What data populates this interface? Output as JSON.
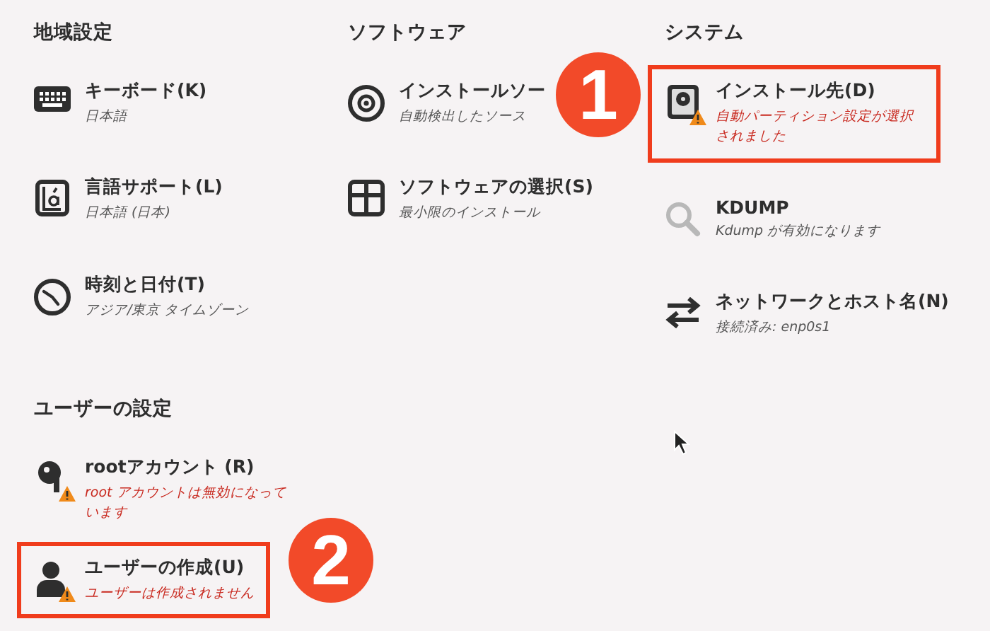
{
  "sections": [
    {
      "title": "地域設定",
      "items": [
        {
          "kind": "keyboard",
          "title": "キーボード(K)",
          "status": "日本語",
          "warning": false,
          "highlighted": false
        },
        {
          "kind": "language",
          "title": "言語サポート(L)",
          "status": "日本語 (日本)",
          "warning": false,
          "highlighted": false
        },
        {
          "kind": "clock",
          "title": "時刻と日付(T)",
          "status": "アジア/東京 タイムゾーン",
          "warning": false,
          "highlighted": false
        }
      ]
    },
    {
      "title": "ソフトウェア",
      "items": [
        {
          "kind": "disc",
          "title": "インストールソー",
          "status": "自動検出したソース",
          "warning": false,
          "highlighted": false
        },
        {
          "kind": "package",
          "title": "ソフトウェアの選択(S)",
          "status": "最小限のインストール",
          "warning": false,
          "highlighted": false
        }
      ]
    },
    {
      "title": "システム",
      "items": [
        {
          "kind": "disk",
          "title": "インストール先(D)",
          "status": "自動パーティション設定が選択されました",
          "warning": true,
          "highlighted": true,
          "callout": "1"
        },
        {
          "kind": "search",
          "title": "KDUMP",
          "status": "Kdump が有効になります",
          "warning": false,
          "highlighted": false
        },
        {
          "kind": "network",
          "title": "ネットワークとホスト名(N)",
          "status": "接続済み: enp0s1",
          "warning": false,
          "highlighted": false
        }
      ]
    },
    {
      "title": "ユーザーの設定",
      "items": [
        {
          "kind": "key",
          "title": "rootアカウント (R)",
          "status": "root アカウントは無効になっています",
          "warning": true,
          "highlighted": false
        },
        {
          "kind": "user",
          "title": "ユーザーの作成(U)",
          "status": "ユーザーは作成されません",
          "warning": true,
          "highlighted": true,
          "callout": "2"
        }
      ]
    }
  ]
}
